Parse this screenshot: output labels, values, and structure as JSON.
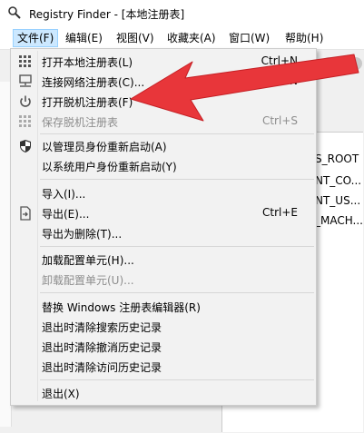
{
  "window": {
    "title": "Registry Finder - [本地注册表]"
  },
  "menubar": {
    "items": [
      {
        "label": "文件(F)"
      },
      {
        "label": "编辑(E)"
      },
      {
        "label": "视图(V)"
      },
      {
        "label": "收藏夹(A)"
      },
      {
        "label": "窗口(W)"
      },
      {
        "label": "帮助(H)"
      }
    ]
  },
  "tree": {
    "items": [
      "S_ROOT",
      "NT_CO...",
      "NT_US...",
      "_MACH..."
    ]
  },
  "file_menu": {
    "items": [
      {
        "label": "打开本地注册表(L)",
        "shortcut": "Ctrl+N",
        "icon": "grid-icon",
        "enabled": true
      },
      {
        "label": "连接网络注册表(C)...",
        "shortcut": "Ctrl+Shift+N",
        "icon": "network-icon",
        "enabled": true
      },
      {
        "label": "打开脱机注册表(F)",
        "shortcut": "",
        "icon": "power-icon",
        "enabled": true
      },
      {
        "label": "保存脱机注册表",
        "shortcut": "Ctrl+S",
        "icon": "grid-icon",
        "enabled": false
      },
      {
        "label": "以管理员身份重新启动(A)",
        "shortcut": "",
        "icon": "shield-icon",
        "enabled": true
      },
      {
        "label": "以系统用户身份重新启动(Y)",
        "shortcut": "",
        "icon": "",
        "enabled": true
      },
      {
        "label": "导入(I)...",
        "shortcut": "",
        "icon": "",
        "enabled": true
      },
      {
        "label": "导出(E)...",
        "shortcut": "Ctrl+E",
        "icon": "export-icon",
        "enabled": true
      },
      {
        "label": "导出为删除(T)...",
        "shortcut": "",
        "icon": "",
        "enabled": true
      },
      {
        "label": "加载配置单元(H)...",
        "shortcut": "",
        "icon": "",
        "enabled": true
      },
      {
        "label": "卸载配置单元(U)...",
        "shortcut": "",
        "icon": "",
        "enabled": false
      },
      {
        "label": "替换 Windows 注册表编辑器(R)",
        "shortcut": "",
        "icon": "",
        "enabled": true
      },
      {
        "label": "退出时清除搜索历史记录",
        "shortcut": "",
        "icon": "",
        "enabled": true
      },
      {
        "label": "退出时清除撤消历史记录",
        "shortcut": "",
        "icon": "",
        "enabled": true
      },
      {
        "label": "退出时清除访问历史记录",
        "shortcut": "",
        "icon": "",
        "enabled": true
      },
      {
        "label": "退出(X)",
        "shortcut": "",
        "icon": "",
        "enabled": true
      }
    ]
  },
  "colors": {
    "highlight": "#cce8ff",
    "arrow": "#e8363a"
  }
}
